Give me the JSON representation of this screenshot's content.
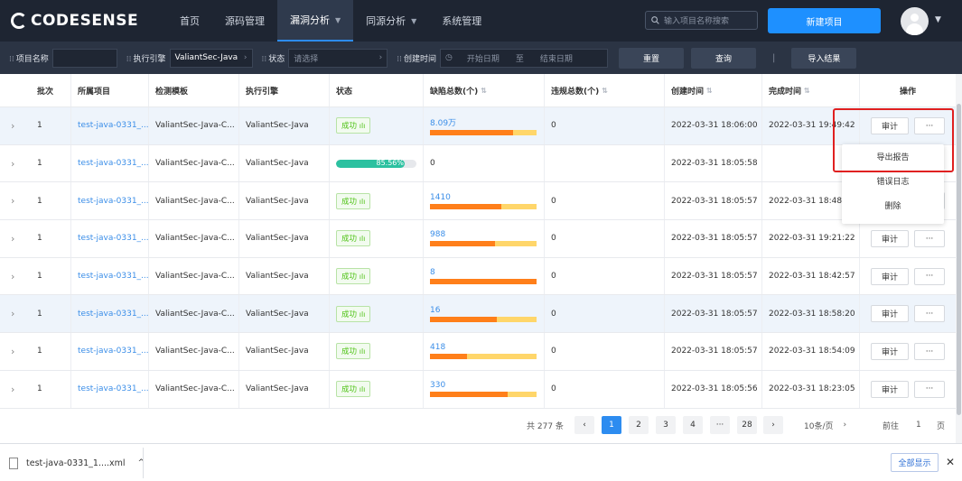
{
  "brand": {
    "logo_text": "CODESENSE"
  },
  "nav": {
    "items": [
      {
        "label": "首页",
        "has_menu": false,
        "active": false
      },
      {
        "label": "源码管理",
        "has_menu": false,
        "active": false
      },
      {
        "label": "漏洞分析",
        "has_menu": true,
        "active": true
      },
      {
        "label": "同源分析",
        "has_menu": true,
        "active": false
      },
      {
        "label": "系统管理",
        "has_menu": false,
        "active": false
      }
    ],
    "search_placeholder": "输入项目名称搜索",
    "new_project_label": "新建项目"
  },
  "filters": {
    "project_name_label": "项目名称",
    "project_name_value": "",
    "engine_label": "执行引擎",
    "engine_value": "ValiantSec-Java",
    "status_label": "状态",
    "status_placeholder": "请选择",
    "created_label": "创建时间",
    "start_placeholder": "开始日期",
    "date_sep": "至",
    "end_placeholder": "结束日期",
    "reset_label": "重置",
    "query_label": "查询",
    "sep": "|",
    "import_label": "导入结果"
  },
  "table": {
    "headers": {
      "batch": "批次",
      "project": "所属项目",
      "template": "检测模板",
      "engine": "执行引擎",
      "status": "状态",
      "defects": "缺陷总数(个)",
      "violations": "违规总数(个)",
      "created": "创建时间",
      "finished": "完成时间",
      "actions": "操作"
    },
    "rows": [
      {
        "batch": "1",
        "project": "test-java-0331_...",
        "template": "ValiantSec-Java-C...",
        "engine": "ValiantSec-Java",
        "status": "成功",
        "defects": "8.09万",
        "defect_ratio": 0.78,
        "violations": "0",
        "created": "2022-03-31 18:06:00",
        "finished": "2022-03-31 19:49:42",
        "highlight": true
      },
      {
        "batch": "1",
        "project": "test-java-0331_...",
        "template": "ValiantSec-Java-C...",
        "engine": "ValiantSec-Java",
        "status": "",
        "progress": 0.8556,
        "progress_text": "85.56%",
        "defects": "0",
        "violations": "",
        "created": "2022-03-31 18:05:58",
        "finished": "",
        "highlight": false
      },
      {
        "batch": "1",
        "project": "test-java-0331_...",
        "template": "ValiantSec-Java-C...",
        "engine": "ValiantSec-Java",
        "status": "成功",
        "defects": "1410",
        "defect_ratio": 0.67,
        "violations": "0",
        "created": "2022-03-31 18:05:57",
        "finished": "2022-03-31 18:48:53",
        "highlight": false
      },
      {
        "batch": "1",
        "project": "test-java-0331_...",
        "template": "ValiantSec-Java-C...",
        "engine": "ValiantSec-Java",
        "status": "成功",
        "defects": "988",
        "defect_ratio": 0.61,
        "violations": "0",
        "created": "2022-03-31 18:05:57",
        "finished": "2022-03-31 19:21:22",
        "highlight": false
      },
      {
        "batch": "1",
        "project": "test-java-0331_...",
        "template": "ValiantSec-Java-C...",
        "engine": "ValiantSec-Java",
        "status": "成功",
        "defects": "8",
        "defect_ratio": 1.0,
        "violations": "0",
        "created": "2022-03-31 18:05:57",
        "finished": "2022-03-31 18:42:57",
        "highlight": false
      },
      {
        "batch": "1",
        "project": "test-java-0331_...",
        "template": "ValiantSec-Java-C...",
        "engine": "ValiantSec-Java",
        "status": "成功",
        "defects": "16",
        "defect_ratio": 0.63,
        "violations": "0",
        "created": "2022-03-31 18:05:57",
        "finished": "2022-03-31 18:58:20",
        "highlight": true
      },
      {
        "batch": "1",
        "project": "test-java-0331_...",
        "template": "ValiantSec-Java-C...",
        "engine": "ValiantSec-Java",
        "status": "成功",
        "defects": "418",
        "defect_ratio": 0.35,
        "violations": "0",
        "created": "2022-03-31 18:05:57",
        "finished": "2022-03-31 18:54:09",
        "highlight": false
      },
      {
        "batch": "1",
        "project": "test-java-0331_...",
        "template": "ValiantSec-Java-C...",
        "engine": "ValiantSec-Java",
        "status": "成功",
        "defects": "330",
        "defect_ratio": 0.73,
        "violations": "0",
        "created": "2022-03-31 18:05:56",
        "finished": "2022-03-31 18:23:05",
        "highlight": false
      }
    ],
    "audit_label": "审计",
    "more_label": "···"
  },
  "row_menu": {
    "items": [
      "导出报告",
      "错误日志",
      "删除"
    ]
  },
  "pagination": {
    "total_text": "共 277 条",
    "prev": "‹",
    "pages": [
      "1",
      "2",
      "3",
      "4",
      "···",
      "28"
    ],
    "current": "1",
    "next": "›",
    "page_size": "10条/页",
    "page_size_arrow": "›",
    "goto_label": "前往",
    "goto_value": "1",
    "goto_suffix": "页"
  },
  "download_bar": {
    "file_name": "test-java-0331_1....xml",
    "chevron": "^",
    "show_all_label": "全部显示",
    "close": "✕"
  },
  "colors": {
    "nav_bg": "#1e2532",
    "filter_bg": "#2b3444",
    "primary": "#1e90ff",
    "defect_high": "#ff7f1a",
    "defect_low": "#ffd66a",
    "progress": "#2cc1a0",
    "success": "#52c41a",
    "highlight_border": "#e02020"
  }
}
